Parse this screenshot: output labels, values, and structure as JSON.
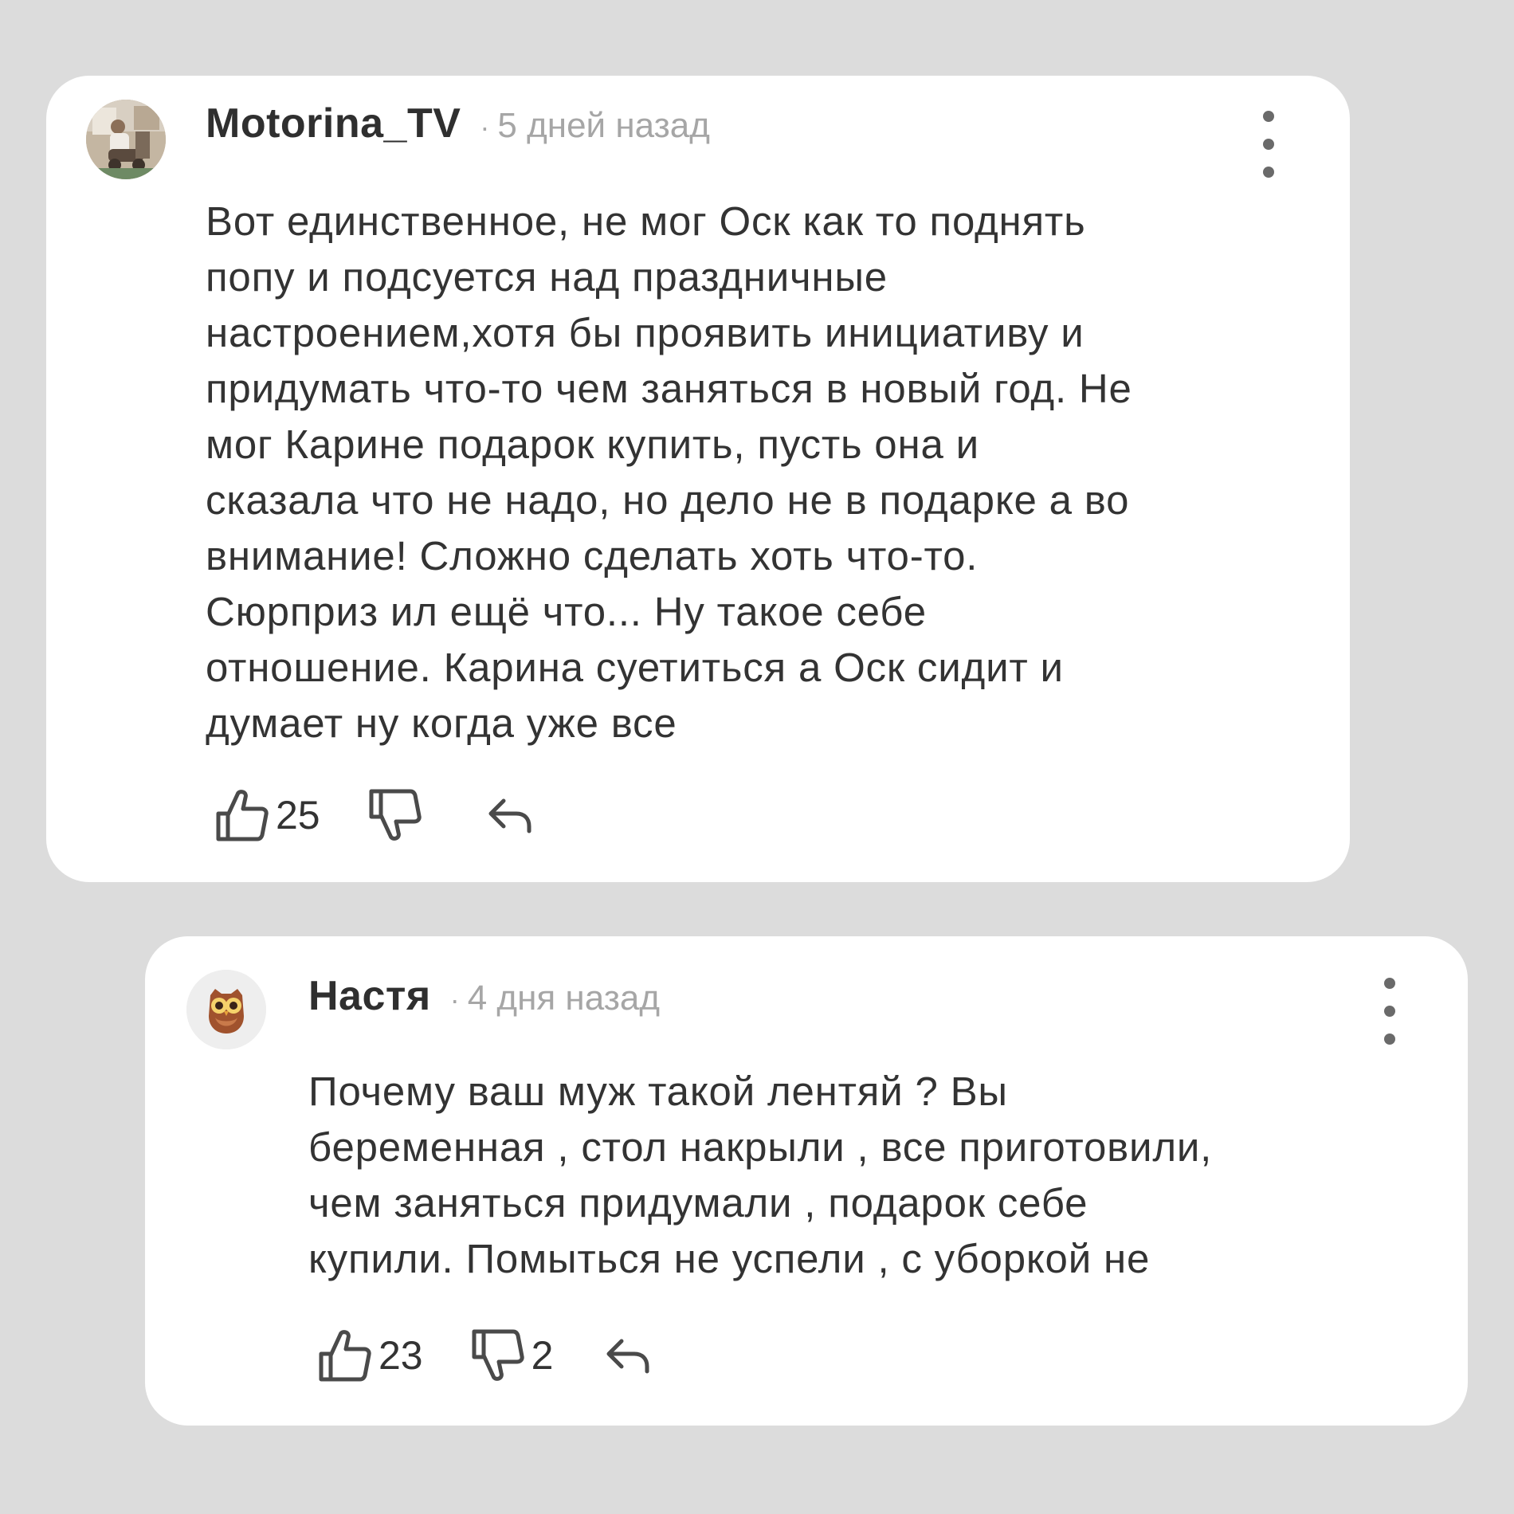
{
  "comments": [
    {
      "username": "Motorina_TV",
      "separator": "·",
      "time": "5 дней назад",
      "avatar_icon": "user-photo-avatar",
      "text_lines": [
        "Вот единственное, не мог Оск как то поднять",
        "попу и подсуется над праздничные",
        "настроением,хотя бы проявить инициативу и",
        "придумать что-то чем заняться в новый год. Не",
        "мог Карине подарок купить, пусть она и",
        "сказала что не надо, но дело не в подарке а во",
        "внимание! Сложно сделать хоть что-то.",
        "Сюрприз ил ещё что... Ну такое себе",
        "отношение. Карина суетиться а Оск сидит и",
        "думает ну когда уже все"
      ],
      "likes": "25",
      "dislikes": ""
    },
    {
      "username": "Настя",
      "separator": "·",
      "time": "4 дня назад",
      "avatar_icon": "owl-avatar",
      "text_lines": [
        "Почему ваш муж такой лентяй ? Вы",
        "беременная , стол накрыли , все приготовили,",
        "чем заняться придумали , подарок себе",
        "купили. Помыться не успели , с уборкой не"
      ],
      "likes": "23",
      "dislikes": "2"
    }
  ],
  "colors": {
    "background": "#dcdcdc",
    "card": "#ffffff",
    "text": "#333333",
    "muted": "#a6a6a6",
    "icon": "#4a4a4a"
  }
}
